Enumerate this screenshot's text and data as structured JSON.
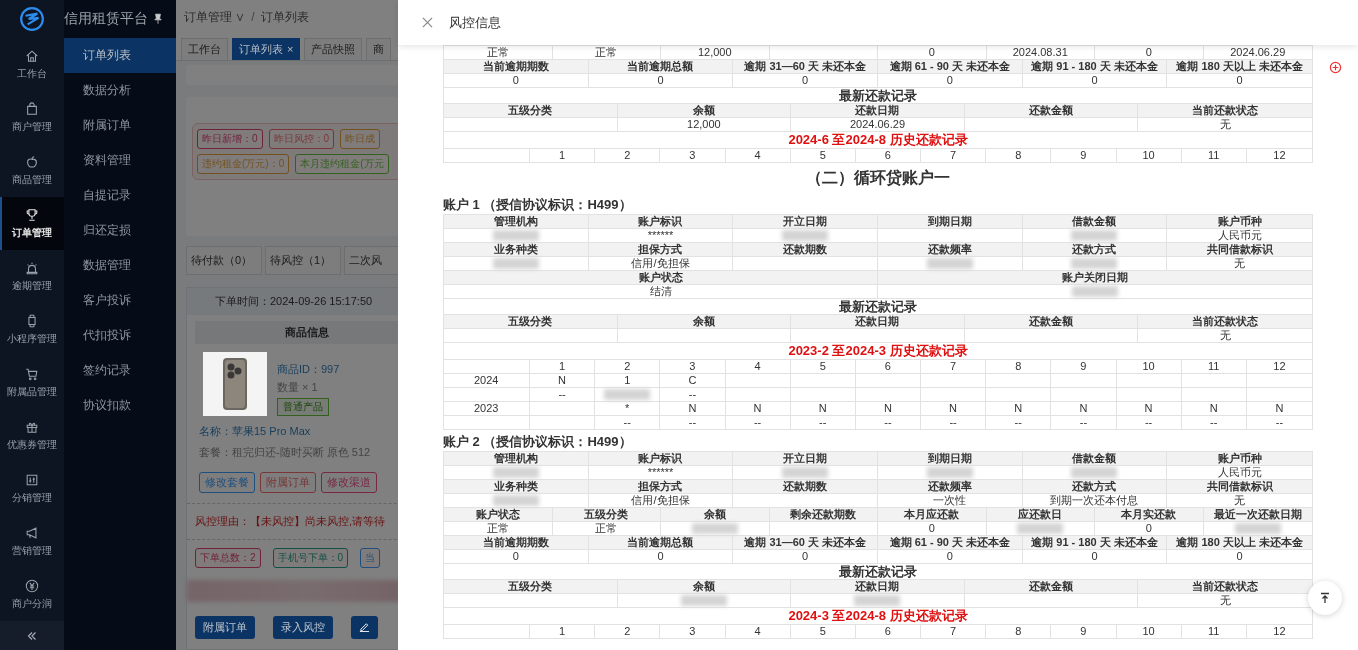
{
  "app": {
    "brand": "信用租赁平台",
    "nav": [
      {
        "label": "工作台",
        "selected": false
      },
      {
        "label": "商户管理",
        "selected": false
      },
      {
        "label": "商品管理",
        "selected": false
      },
      {
        "label": "订单管理",
        "selected": true
      },
      {
        "label": "逾期管理",
        "selected": false
      },
      {
        "label": "小程序管理",
        "selected": false
      },
      {
        "label": "附属品管理",
        "selected": false
      },
      {
        "label": "优惠券管理",
        "selected": false
      },
      {
        "label": "分销管理",
        "selected": false
      },
      {
        "label": "营销管理",
        "selected": false
      },
      {
        "label": "商户分润",
        "selected": false
      }
    ],
    "submenu": [
      {
        "label": "订单列表",
        "selected": true
      },
      {
        "label": "数据分析",
        "selected": false
      },
      {
        "label": "附属订单",
        "selected": false
      },
      {
        "label": "资料管理",
        "selected": false
      },
      {
        "label": "自提记录",
        "selected": false
      },
      {
        "label": "归还定损",
        "selected": false
      },
      {
        "label": "数据管理",
        "selected": false
      },
      {
        "label": "客户投诉",
        "selected": false
      },
      {
        "label": "代扣投诉",
        "selected": false
      },
      {
        "label": "签约记录",
        "selected": false
      },
      {
        "label": "协议扣款",
        "selected": false
      }
    ],
    "breadcrumb": {
      "items": [
        "订单管理 ∨",
        "订单列表"
      ],
      "separator": "/"
    },
    "tabs": [
      {
        "label": "工作台",
        "selected": false
      },
      {
        "label": "订单列表",
        "selected": true,
        "close": "×"
      },
      {
        "label": "产品快照",
        "selected": false
      },
      {
        "label": "商",
        "selected": false
      }
    ],
    "stats": [
      {
        "text": "昨日新增：0",
        "color": "#70223d"
      },
      {
        "text": "昨日风控：0",
        "color": "#7a3636"
      },
      {
        "text": "昨日成",
        "color": "#73511e"
      },
      {
        "text": "违约租金(万元)：0",
        "color": "#73511e"
      },
      {
        "text": "本月违约租金(万元",
        "color": "#33611d"
      }
    ],
    "status_tabs": [
      {
        "label": "待付款（0）",
        "selected": false
      },
      {
        "label": "待风控（1）",
        "selected": false
      },
      {
        "label": "二次风",
        "selected": false
      }
    ],
    "order": {
      "time": "下单时间：2024-09-26 15:17:50",
      "product_header": "商品信息",
      "product_id": "商品ID：997",
      "quantity": "数量 × 1",
      "tag": "普通产品",
      "name": "名称：苹果15 Pro Max",
      "package": "套餐：租完归还-随时买断 原色 512",
      "actions": [
        {
          "text": "修改套餐",
          "color": "#204f7f"
        },
        {
          "text": "附属订单",
          "color": "#7a3636"
        },
        {
          "text": "修改渠道",
          "color": "#782845"
        }
      ],
      "risk": "风控理由：【未风控】尚未风控,请等待",
      "counts": [
        {
          "text": "下单总数：2",
          "color": "#70223d"
        },
        {
          "text": "手机号下单：0",
          "color": "#105045"
        },
        {
          "text": "当",
          "color": "#204f7f"
        }
      ],
      "buttons": [
        "附属订单",
        "录入风控"
      ]
    }
  },
  "drawer": {
    "title": "风控信息",
    "sections": [
      {
        "kind": "table",
        "rows": [
          {
            "kind": "value",
            "cells": [
              "正常",
              "正常",
              "12,000",
              null,
              "0",
              "2024.08.31",
              "0",
              "2024.06.29"
            ]
          },
          {
            "kind": "head",
            "cells": [
              "当前逾期期数",
              "当前逾期总额",
              "逾期 31—60 天 未还本金",
              "逾期 61 - 90 天 未还本金",
              "逾期 91 - 180 天 未还本金",
              "逾期 180 天以上 未还本金"
            ]
          },
          {
            "kind": "value",
            "cells": [
              "0",
              "0",
              "0",
              "0",
              "0",
              "0"
            ]
          },
          {
            "kind": "title",
            "text": "最新还款记录"
          },
          {
            "kind": "head",
            "cells": [
              "五级分类",
              "余额",
              "还款日期",
              "还款金额",
              "当前还款状态"
            ]
          },
          {
            "kind": "value",
            "cells": [
              null,
              "12,000",
              "2024.06.29",
              null,
              "无"
            ]
          },
          {
            "kind": "alert",
            "text": "2024-6 至2024-8 历史还款记录"
          },
          {
            "kind": "history",
            "cells": [
              null,
              "1",
              "2",
              "3",
              "4",
              "5",
              "6",
              "7",
              "8",
              "9",
              "10",
              "11",
              "12"
            ]
          }
        ]
      },
      {
        "kind": "section",
        "text": "（二）循环贷账户一"
      },
      {
        "kind": "account",
        "text": "账户 1 （授信协议标识：H499）"
      },
      {
        "kind": "table",
        "rows": [
          {
            "kind": "head",
            "cells": [
              "管理机构",
              "账户标识",
              "开立日期",
              "到期日期",
              "借款金额",
              "账户币种"
            ]
          },
          {
            "kind": "value",
            "cells": [
              {
                "kind": "redacted"
              },
              "******",
              {
                "kind": "redacted"
              },
              null,
              {
                "kind": "redacted"
              },
              "人民币元"
            ]
          },
          {
            "kind": "head",
            "cells": [
              "业务种类",
              "担保方式",
              "还款期数",
              "还款频率",
              "还款方式",
              "共同借款标识"
            ]
          },
          {
            "kind": "value",
            "cells": [
              {
                "kind": "redacted"
              },
              "信用/免担保",
              null,
              {
                "kind": "redacted"
              },
              {
                "kind": "redacted"
              },
              "无"
            ]
          },
          {
            "kind": "head",
            "cells": [
              "账户状态",
              "账户关闭日期"
            ]
          },
          {
            "kind": "value",
            "cells": [
              "结清",
              {
                "kind": "redacted"
              }
            ]
          },
          {
            "kind": "title",
            "text": "最新还款记录"
          },
          {
            "kind": "head",
            "cells": [
              "五级分类",
              "余额",
              "还款日期",
              "还款金额",
              "当前还款状态"
            ]
          },
          {
            "kind": "value",
            "cells": [
              null,
              null,
              null,
              null,
              "无"
            ]
          },
          {
            "kind": "alert",
            "text": "2023-2 至2024-3 历史还款记录"
          },
          {
            "kind": "history",
            "cells": [
              null,
              "1",
              "2",
              "3",
              "4",
              "5",
              "6",
              "7",
              "8",
              "9",
              "10",
              "11",
              "12"
            ]
          },
          {
            "kind": "history",
            "cells": [
              "2024",
              "N",
              "1",
              "C",
              null,
              null,
              null,
              null,
              null,
              null,
              null,
              null,
              null
            ]
          },
          {
            "kind": "history",
            "cells": [
              null,
              "--",
              {
                "kind": "redacted"
              },
              "--",
              null,
              null,
              null,
              null,
              null,
              null,
              null,
              null,
              null
            ]
          },
          {
            "kind": "history",
            "cells": [
              "2023",
              null,
              "*",
              "N",
              "N",
              "N",
              "N",
              "N",
              "N",
              "N",
              "N",
              "N",
              "N"
            ]
          },
          {
            "kind": "history",
            "cells": [
              null,
              null,
              "--",
              "--",
              "--",
              "--",
              "--",
              "--",
              "--",
              "--",
              "--",
              "--",
              "--"
            ]
          }
        ]
      },
      {
        "kind": "account",
        "text": "账户 2 （授信协议标识：H499）"
      },
      {
        "kind": "table",
        "rows": [
          {
            "kind": "head",
            "cells": [
              "管理机构",
              "账户标识",
              "开立日期",
              "到期日期",
              "借款金额",
              "账户币种"
            ]
          },
          {
            "kind": "value",
            "cells": [
              {
                "kind": "redacted"
              },
              "******",
              {
                "kind": "redacted"
              },
              {
                "kind": "redacted"
              },
              {
                "kind": "redacted"
              },
              "人民币元"
            ]
          },
          {
            "kind": "head",
            "cells": [
              "业务种类",
              "担保方式",
              "还款期数",
              "还款频率",
              "还款方式",
              "共同借款标识"
            ]
          },
          {
            "kind": "value",
            "cells": [
              {
                "kind": "redacted"
              },
              "信用/免担保",
              null,
              "一次性",
              "到期一次还本付息",
              "无"
            ]
          },
          {
            "kind": "head",
            "cells": [
              "账户状态",
              "五级分类",
              "余额",
              "剩余还款期数",
              "本月应还款",
              "应还款日",
              "本月实还款",
              "最近一次还款日期"
            ]
          },
          {
            "kind": "value",
            "cells": [
              "正常",
              "正常",
              {
                "kind": "redacted"
              },
              null,
              "0",
              {
                "kind": "redacted"
              },
              "0",
              {
                "kind": "redacted"
              }
            ]
          },
          {
            "kind": "head",
            "cells": [
              "当前逾期期数",
              "当前逾期总额",
              "逾期 31—60 天 未还本金",
              "逾期 61 - 90 天 未还本金",
              "逾期 91 - 180 天 未还本金",
              "逾期 180 天以上 未还本金"
            ]
          },
          {
            "kind": "value",
            "cells": [
              "0",
              "0",
              "0",
              "0",
              "0",
              "0"
            ]
          },
          {
            "kind": "title",
            "text": "最新还款记录"
          },
          {
            "kind": "head",
            "cells": [
              "五级分类",
              "余额",
              "还款日期",
              "还款金额",
              "当前还款状态"
            ]
          },
          {
            "kind": "value",
            "cells": [
              null,
              {
                "kind": "redacted"
              },
              {
                "kind": "redacted"
              },
              null,
              "无"
            ]
          },
          {
            "kind": "alert",
            "text": "2024-3 至2024-8 历史还款记录"
          },
          {
            "kind": "history",
            "cells": [
              null,
              "1",
              "2",
              "3",
              "4",
              "5",
              "6",
              "7",
              "8",
              "9",
              "10",
              "11",
              "12"
            ]
          }
        ]
      }
    ]
  }
}
